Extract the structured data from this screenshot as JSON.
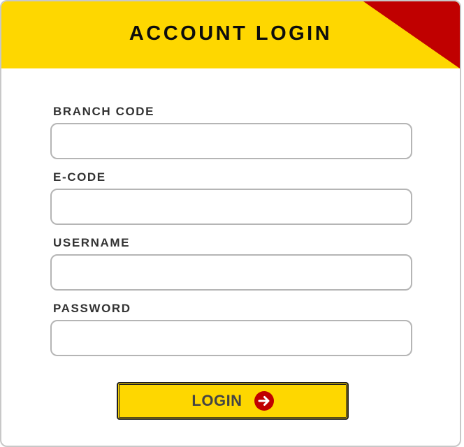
{
  "header": {
    "title": "ACCOUNT LOGIN"
  },
  "form": {
    "fields": [
      {
        "label": "BRANCH CODE",
        "value": "",
        "placeholder": ""
      },
      {
        "label": "E-CODE",
        "value": "",
        "placeholder": ""
      },
      {
        "label": "USERNAME",
        "value": "",
        "placeholder": ""
      },
      {
        "label": "PASSWORD",
        "value": "",
        "placeholder": ""
      }
    ],
    "submit_label": "LOGIN",
    "submit_icon": "arrow-right-circle-icon"
  },
  "colors": {
    "header_background": "#fed700",
    "header_corner": "#c00000",
    "button_background": "#fed700",
    "button_icon": "#c00000",
    "input_border": "#b5b5b5"
  }
}
